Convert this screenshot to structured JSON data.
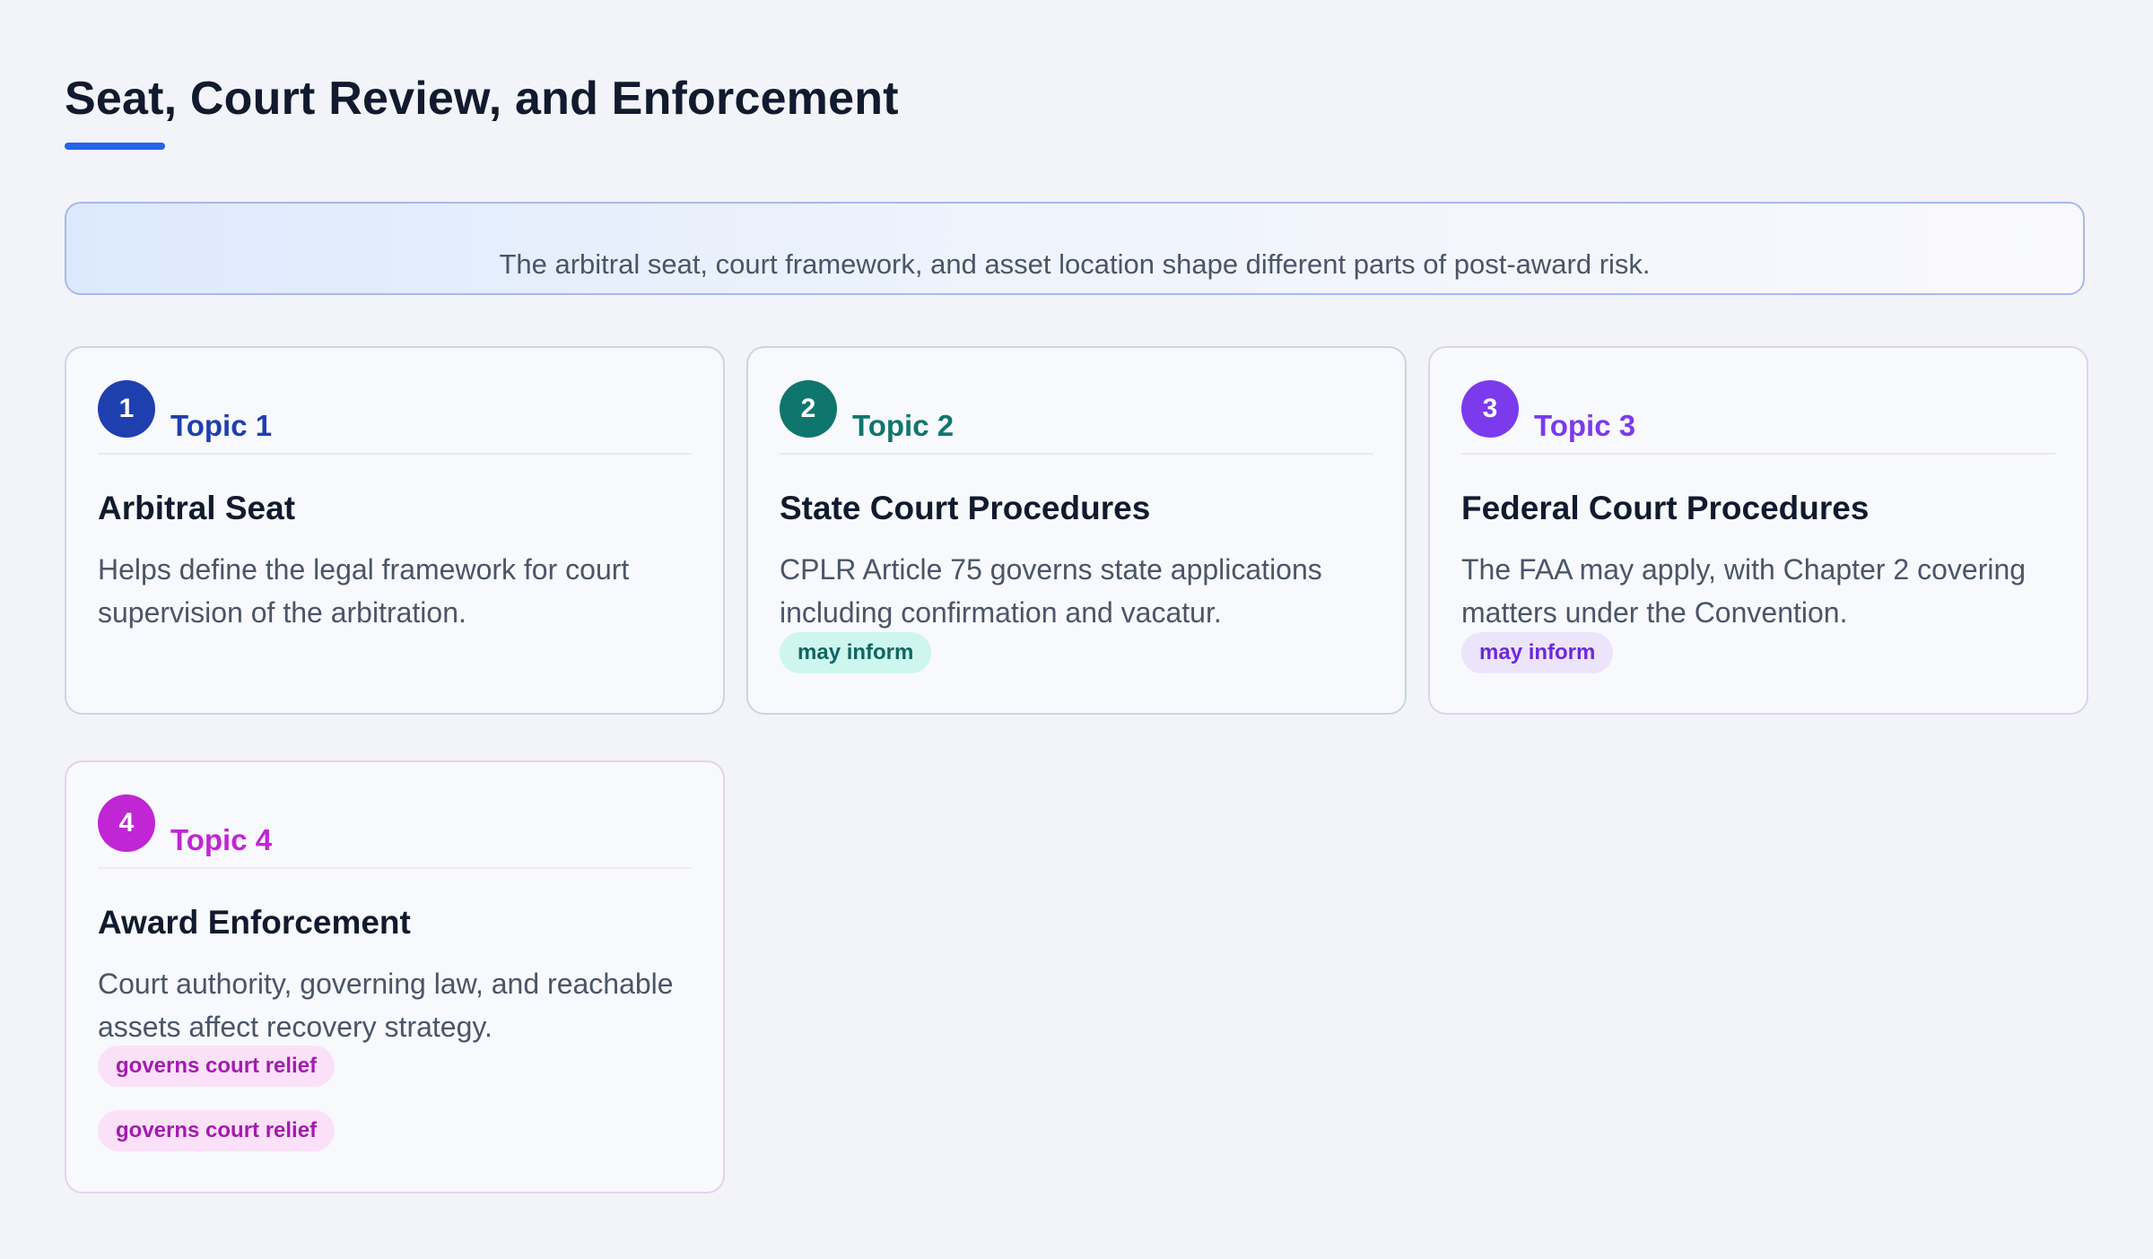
{
  "title": "Seat, Court Review, and Enforcement",
  "summary": "The arbitral seat, court framework, and asset location shape different parts of post-award risk.",
  "colors": {
    "accent": "#2563eb",
    "topic1": "#1e3fae",
    "topic2": "#0f766e",
    "topic3": "#7c3aed",
    "topic4": "#c026d3"
  },
  "cards": [
    {
      "number": "1",
      "topic": "Topic 1",
      "title": "Arbitral Seat",
      "description": "Helps define the legal framework for court supervision of the arbitration.",
      "tags": []
    },
    {
      "number": "2",
      "topic": "Topic 2",
      "title": "State Court Procedures",
      "description": "CPLR Article 75 governs state applications including confirmation and vacatur.",
      "tags": [
        "may inform"
      ]
    },
    {
      "number": "3",
      "topic": "Topic 3",
      "title": "Federal Court Procedures",
      "description": "The FAA may apply, with Chapter 2 covering matters under the Convention.",
      "tags": [
        "may inform"
      ]
    },
    {
      "number": "4",
      "topic": "Topic 4",
      "title": "Award Enforcement",
      "description": "Court authority, governing law, and reachable assets affect recovery strategy.",
      "tags": [
        "governs court relief",
        "governs court relief"
      ]
    }
  ]
}
